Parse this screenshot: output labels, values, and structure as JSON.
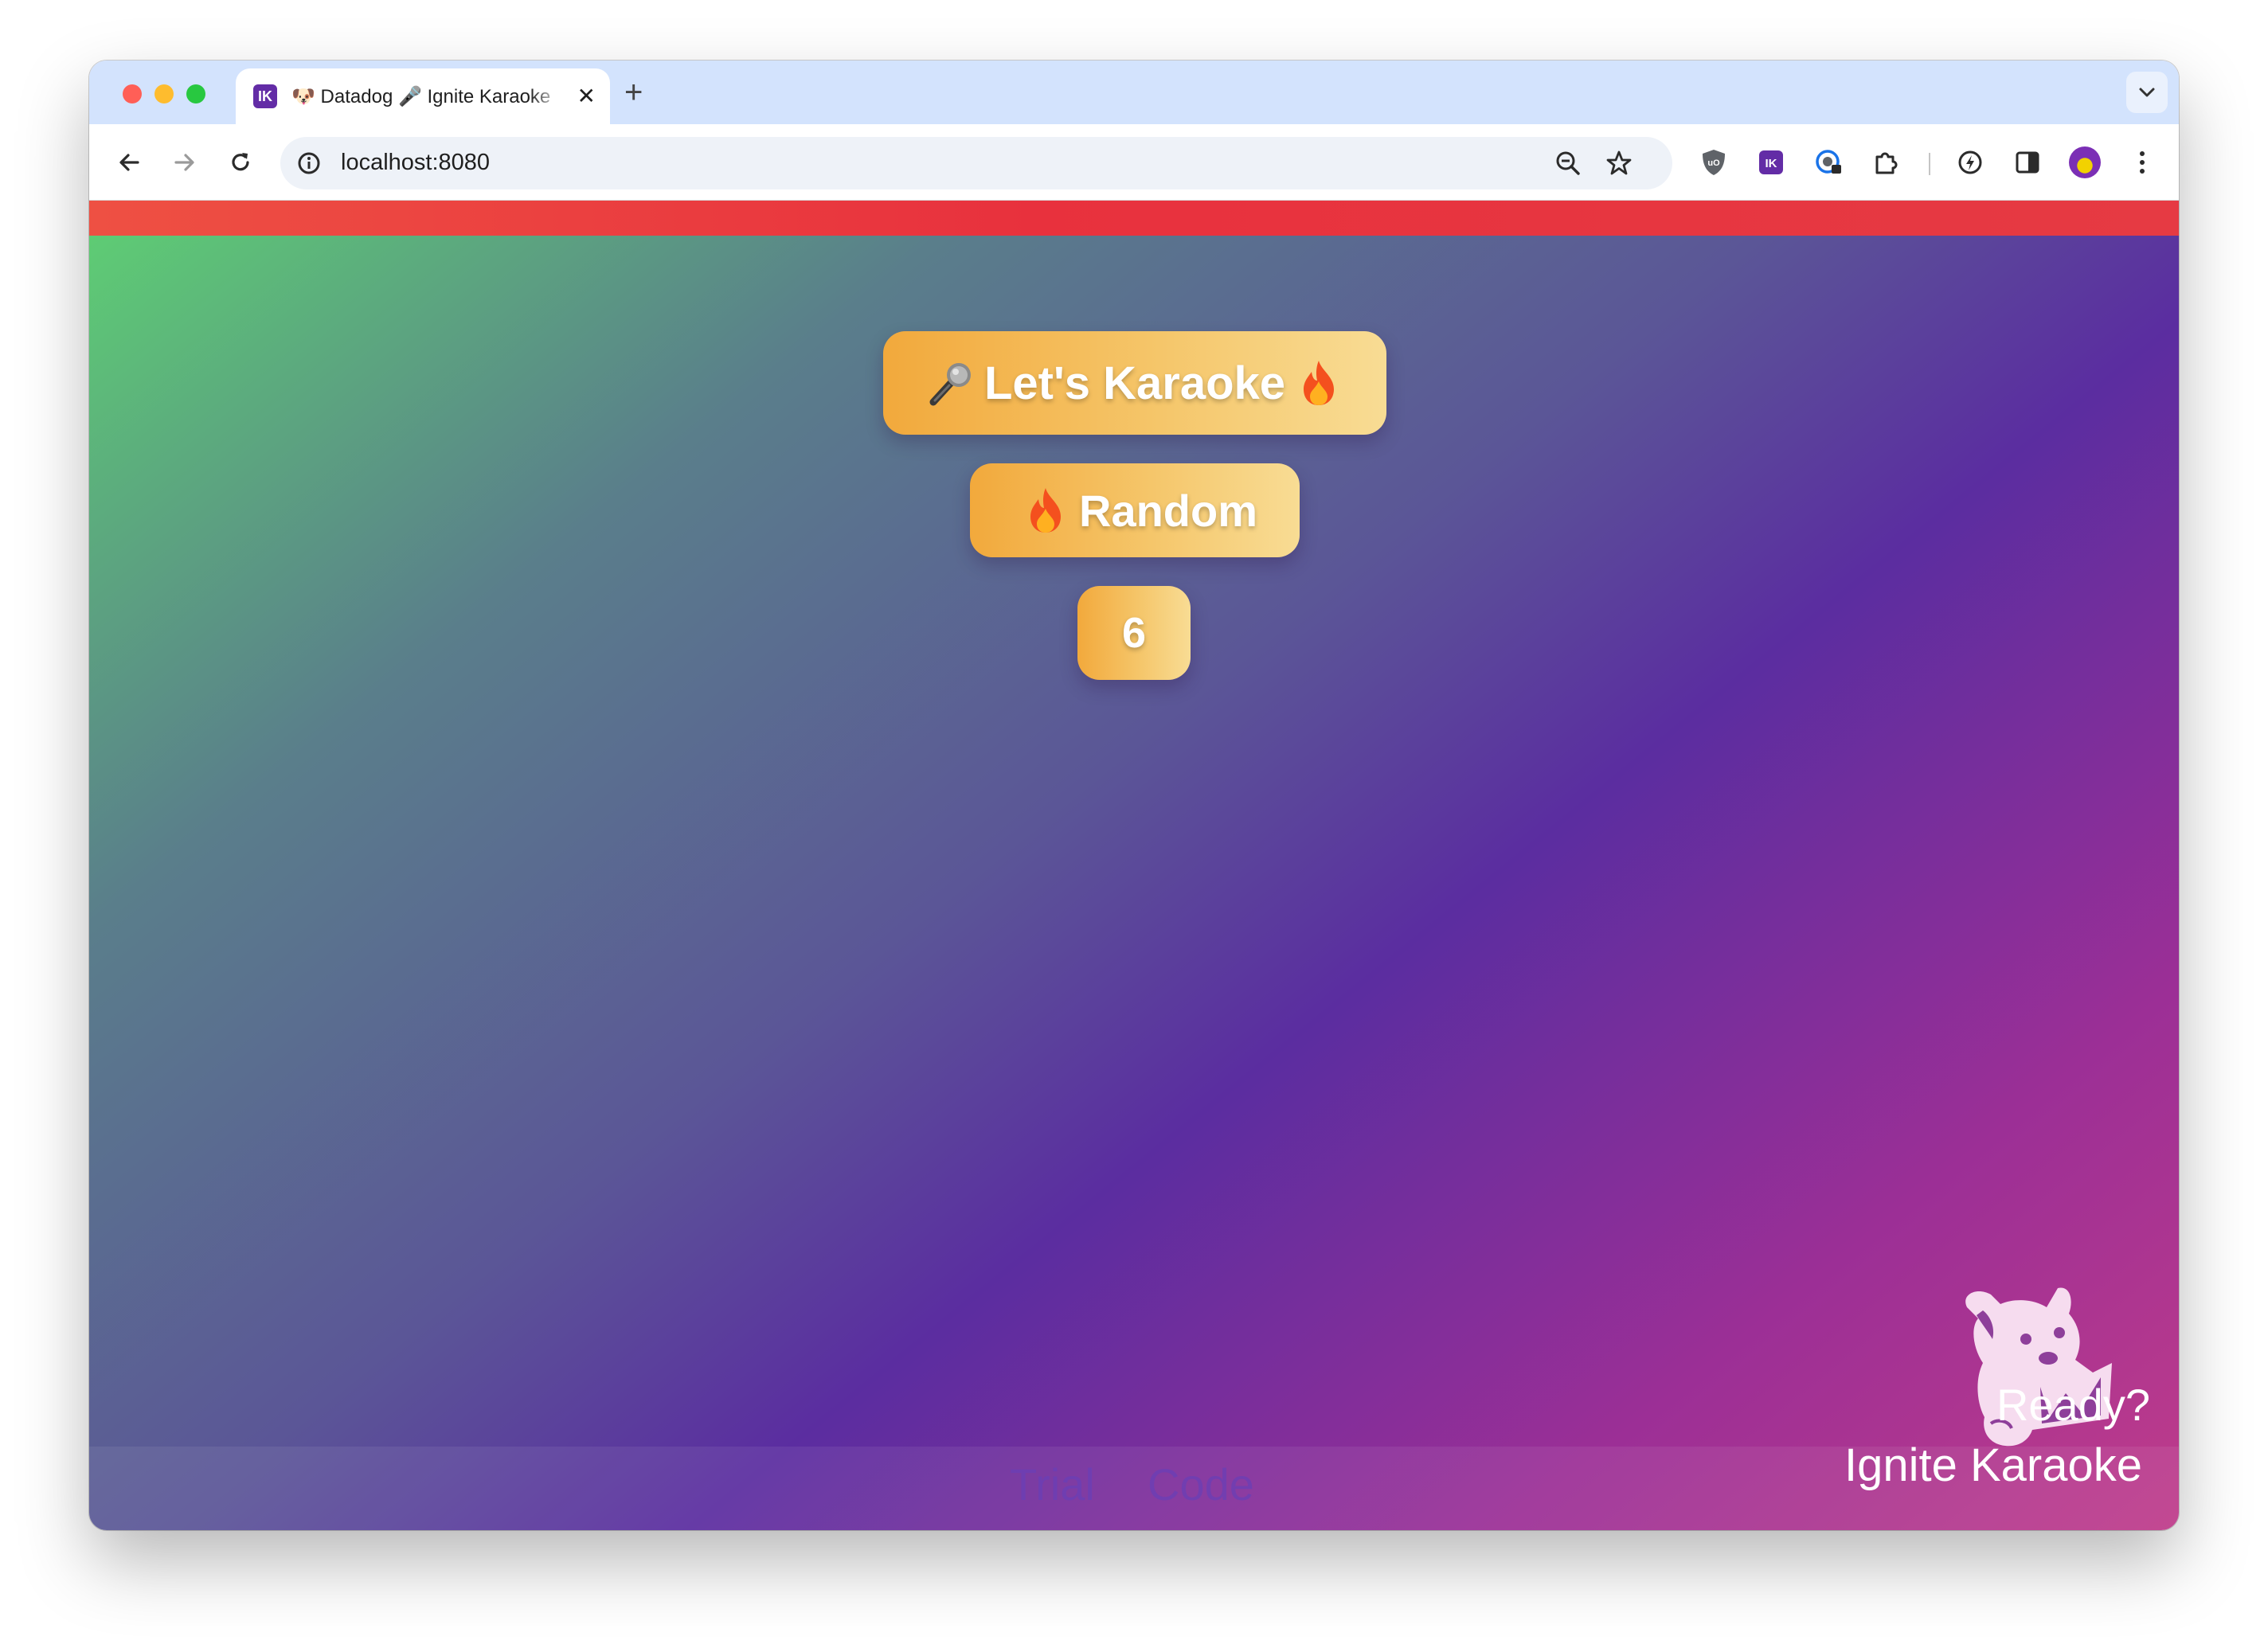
{
  "browser": {
    "tab": {
      "favicon_text": "IK",
      "title": "🐶 Datadog 🎤 Ignite Karaoke"
    },
    "new_tab_label": "+",
    "close_tab_label": "✕",
    "address": "localhost:8080"
  },
  "page": {
    "karaoke_button": {
      "icon_left": "microphone-icon",
      "label": "Let's Karaoke",
      "icon_right": "fire-icon"
    },
    "random_button": {
      "icon_left": "fire-icon",
      "label": "Random"
    },
    "count_badge": "6",
    "footer_links": [
      "Trial",
      "Code"
    ],
    "ready_text": "Ready?",
    "brand_text": "Ignite Karaoke"
  },
  "colors": {
    "accent_orange": "#f2a93c",
    "top_bar_red": "#e8313d",
    "background_purple": "#5b2da0",
    "background_green": "#5ed073",
    "background_pink": "#bf3c8a"
  }
}
